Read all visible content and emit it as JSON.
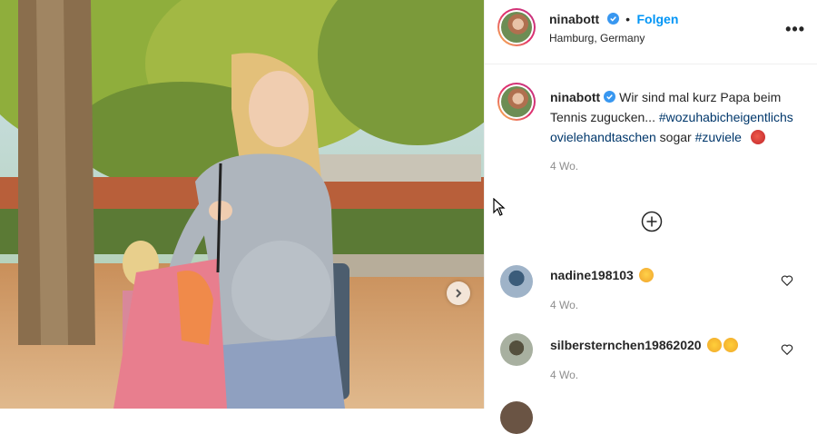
{
  "post_header": {
    "username": "ninabott",
    "follow_label": "Folgen",
    "separator": "•",
    "location": "Hamburg, Germany",
    "more_label": "•••"
  },
  "caption": {
    "username": "ninabott",
    "text": "Wir sind mal kurz Papa beim Tennis zugucken...",
    "hashtag_1": "#wozuhabicheigentlichsovielehandtaschen",
    "text_2": "sogar",
    "hashtag_2": "#zuviele",
    "emoji": "tomato-red-emoji",
    "time": "4 Wo."
  },
  "load_more_icon": "plus-circle-icon",
  "comments": [
    {
      "username": "nadine198103",
      "emoji": "face-savoring-food-emoji",
      "time": "4 Wo."
    },
    {
      "username": "silbersternchen19862020",
      "emoji": "clapping-hands-emoji",
      "time": "4 Wo."
    }
  ],
  "colors": {
    "link_blue": "#0095f6",
    "hashtag": "#00376b",
    "muted": "#8e8e8e",
    "text": "#262626"
  }
}
